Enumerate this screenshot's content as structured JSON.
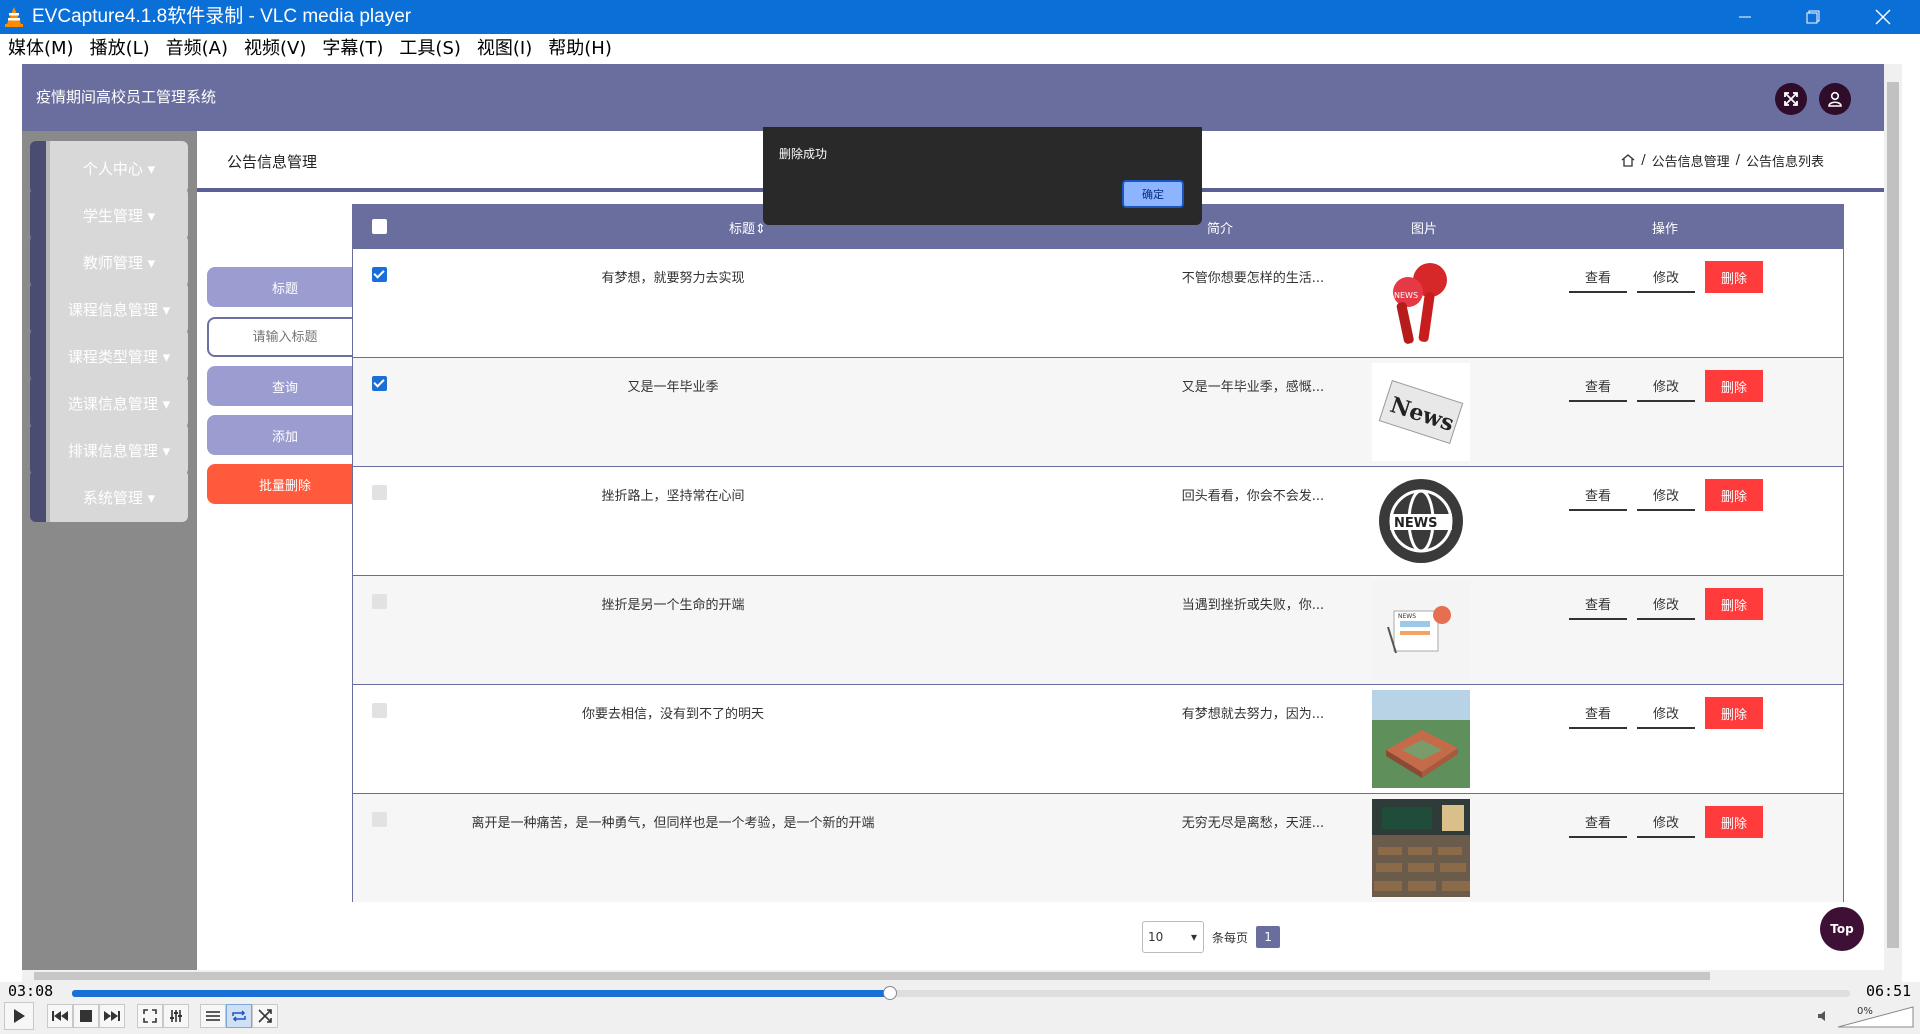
{
  "window": {
    "title": "EVCapture4.1.8软件录制 - VLC media player"
  },
  "menu": [
    "媒体(M)",
    "播放(L)",
    "音频(A)",
    "视频(V)",
    "字幕(T)",
    "工具(S)",
    "视图(I)",
    "帮助(H)"
  ],
  "app": {
    "brand": "疫情期间高校员工管理系统",
    "sidebar": [
      {
        "label": "个人中心"
      },
      {
        "label": "学生管理"
      },
      {
        "label": "教师管理"
      },
      {
        "label": "课程信息管理"
      },
      {
        "label": "课程类型管理"
      },
      {
        "label": "选课信息管理"
      },
      {
        "label": "排课信息管理"
      },
      {
        "label": "系统管理"
      }
    ],
    "page_title": "公告信息管理",
    "breadcrumb": [
      "公告信息管理",
      "公告信息列表"
    ],
    "search": {
      "field_label": "标题",
      "placeholder": "请输入标题",
      "query_button": "查询",
      "add_button": "添加",
      "batch_delete_button": "批量删除"
    },
    "table": {
      "headers": {
        "title": "标题",
        "intro": "简介",
        "image": "图片",
        "actions": "操作"
      },
      "action_labels": {
        "view": "查看",
        "edit": "修改",
        "delete": "删除"
      },
      "rows": [
        {
          "checked": true,
          "title": "有梦想，就要努力去实现",
          "intro": "不管你想要怎样的生活...",
          "image": "microphone-news-image"
        },
        {
          "checked": true,
          "title": "又是一年毕业季",
          "intro": "又是一年毕业季，感慨...",
          "image": "newspaper-image"
        },
        {
          "checked": false,
          "title": "挫折路上，坚持常在心间",
          "intro": "回头看看，你会不会发...",
          "image": "globe-news-image"
        },
        {
          "checked": false,
          "title": "挫折是另一个生命的开端",
          "intro": "当遇到挫折或失败，你...",
          "image": "news-illustration-image"
        },
        {
          "checked": false,
          "title": "你要去相信，没有到不了的明天",
          "intro": "有梦想就去努力，因为...",
          "image": "campus-building-image"
        },
        {
          "checked": false,
          "title": "离开是一种痛苦，是一种勇气，但同样也是一个考验，是一个新的开端",
          "intro": "无穷无尽是离愁，天涯...",
          "image": "classroom-image"
        }
      ]
    },
    "pager": {
      "page_size": "10",
      "per_page_label": "条每页",
      "current_page": "1"
    },
    "top_button": "Top",
    "dialog": {
      "message": "删除成功",
      "ok_button": "确定"
    }
  },
  "player": {
    "elapsed": "03:08",
    "total": "06:51",
    "progress": 0.46,
    "volume_label": "0%"
  },
  "colors": {
    "titlebar": "#0b6fd8",
    "header": "#6a6e9e",
    "delete": "#ff3b3b",
    "batch_delete": "#ff5a3c",
    "seek_fill": "#1a6fd6"
  }
}
